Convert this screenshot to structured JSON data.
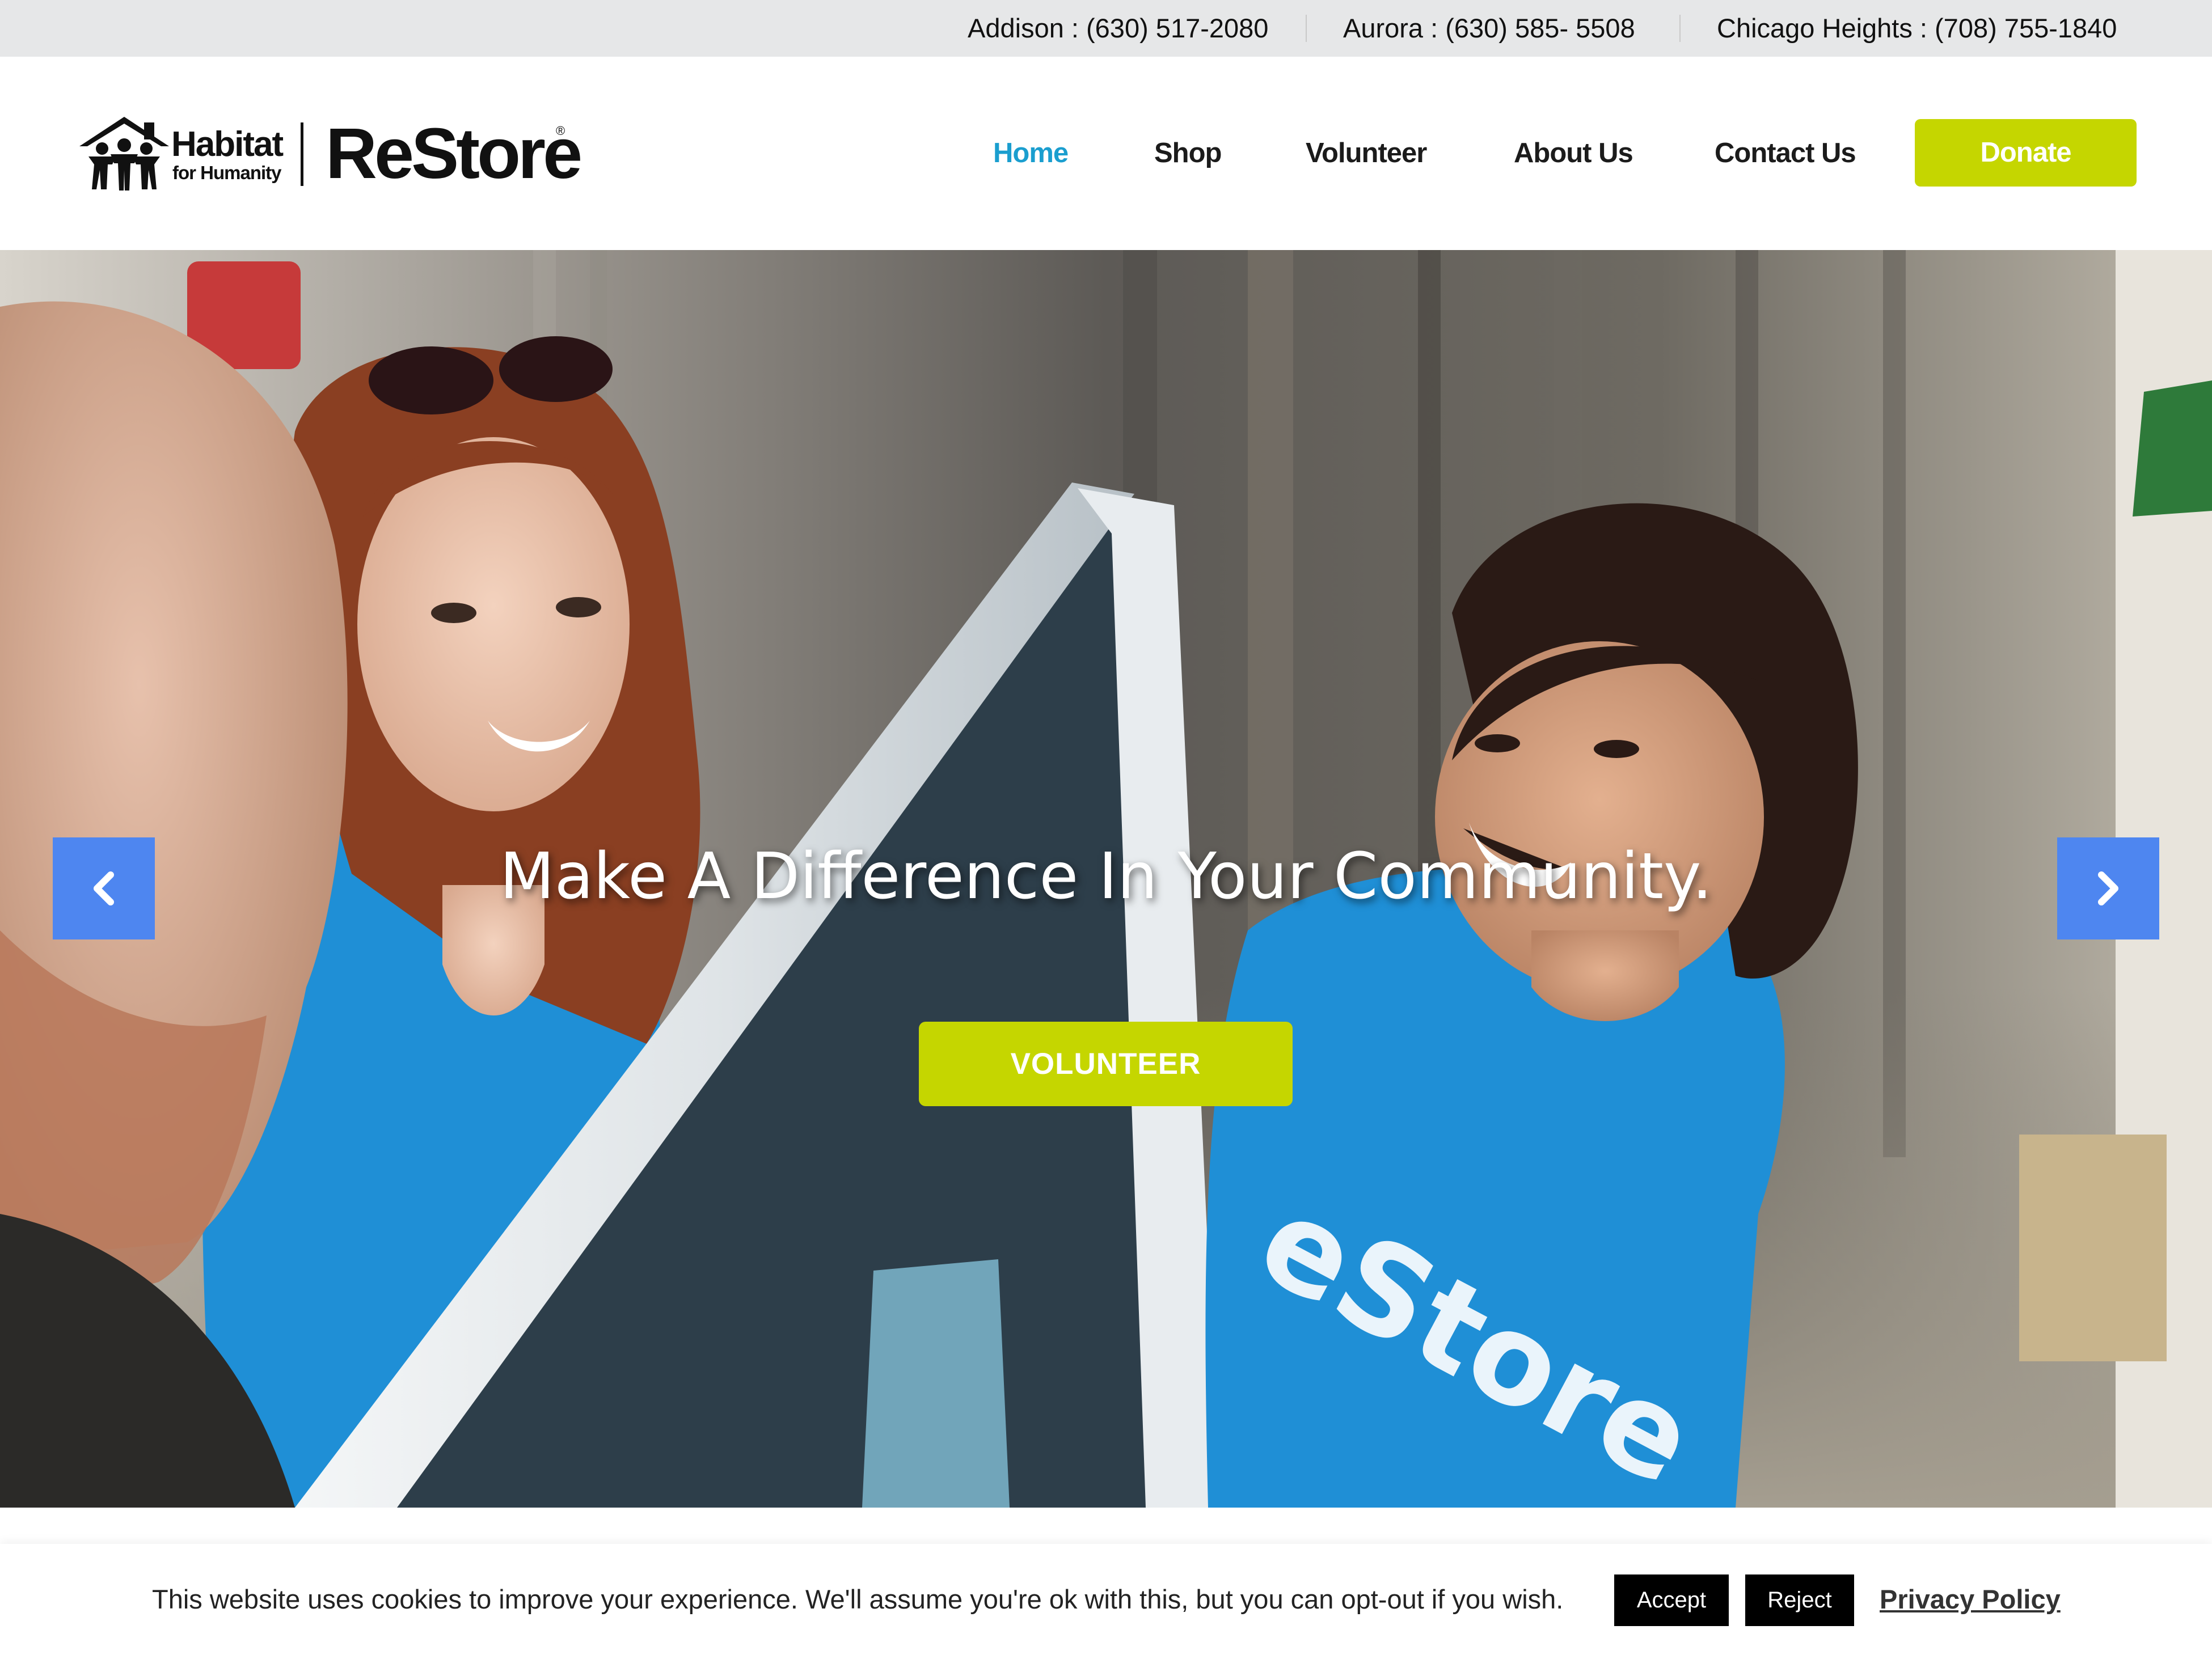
{
  "contact_bar": {
    "phones": [
      {
        "label": "Addison : (630) 517-2080"
      },
      {
        "label": "Aurora : (630) 585- 5508"
      },
      {
        "label": "Chicago Heights : (708) 755-1840"
      }
    ]
  },
  "logo": {
    "habitat": "Habitat",
    "humanity": "for Humanity",
    "restore": "ReStore",
    "registered": "®"
  },
  "nav": {
    "items": [
      {
        "label": "Home",
        "active": true
      },
      {
        "label": "Shop"
      },
      {
        "label": "Volunteer"
      },
      {
        "label": "About Us"
      },
      {
        "label": "Contact Us"
      }
    ],
    "donate_label": "Donate"
  },
  "hero": {
    "title": "Make A Difference In Your Community.",
    "button_label": "VOLUNTEER",
    "prev_icon": "chevron-left-icon",
    "next_icon": "chevron-right-icon"
  },
  "cookie": {
    "message": "This website uses cookies to improve your experience. We'll assume you're ok with this, but you can opt-out if you wish.",
    "accept_label": "Accept",
    "reject_label": "Reject",
    "privacy_label": "Privacy Policy"
  },
  "colors": {
    "accent_green": "#c5d600",
    "nav_active": "#1a9ecf",
    "slider_arrow": "#4e86f0",
    "topbar_bg": "#e6e7e8",
    "shirt_blue": "#1f8fd6"
  }
}
